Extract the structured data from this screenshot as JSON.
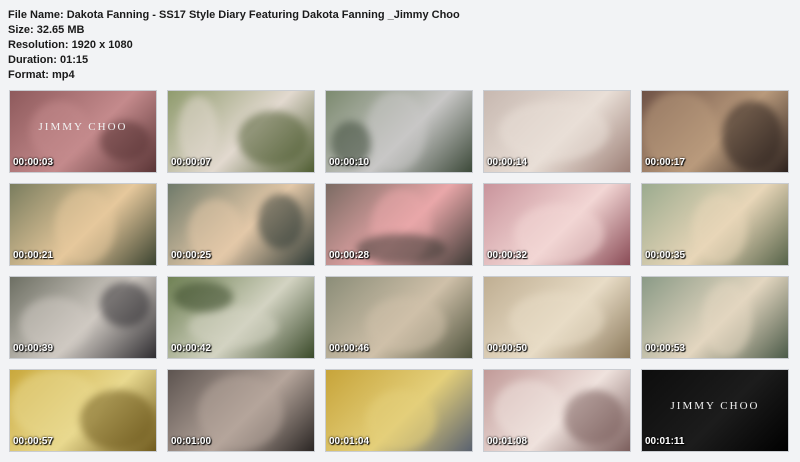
{
  "file_info": {
    "file_name_label": "File Name:",
    "file_name": "Dakota Fanning - SS17 Style Diary Featuring Dakota Fanning _Jimmy Choo",
    "size_label": "Size:",
    "size": "32.65 MB",
    "resolution_label": "Resolution:",
    "resolution": "1920 x 1080",
    "duration_label": "Duration:",
    "duration": "01:15",
    "format_label": "Format:",
    "format": "mp4"
  },
  "thumbnails": [
    {
      "time": "00:00:03",
      "scene": "brand-title-card",
      "colors": [
        "#8e5a5c",
        "#c48a8c",
        "#5a3536"
      ],
      "brand": "JIMMY CHOO"
    },
    {
      "time": "00:00:07",
      "scene": "shoe-closeup-garden",
      "colors": [
        "#8f9b6d",
        "#e2d9cf",
        "#4f5d32"
      ]
    },
    {
      "time": "00:00:10",
      "scene": "woman-on-ladder-garden",
      "colors": [
        "#7c8a6f",
        "#c8c7c6",
        "#3d4a3a"
      ]
    },
    {
      "time": "00:00:14",
      "scene": "pearl-handbag-closeup",
      "colors": [
        "#c7b8b0",
        "#e9dfd7",
        "#9c7f76"
      ]
    },
    {
      "time": "00:00:17",
      "scene": "shoe-rack-display",
      "colors": [
        "#6e5246",
        "#b99a7c",
        "#2c211d"
      ]
    },
    {
      "time": "00:00:21",
      "scene": "portrait-blonde-woman",
      "colors": [
        "#7a7d5e",
        "#e6c89c",
        "#3c4431"
      ]
    },
    {
      "time": "00:00:25",
      "scene": "woman-sunglasses-camera",
      "colors": [
        "#6f7a6a",
        "#e3c8a8",
        "#2f3a35"
      ]
    },
    {
      "time": "00:00:28",
      "scene": "woman-pink-dress",
      "colors": [
        "#7b6b63",
        "#e9a7a9",
        "#3e3a35"
      ]
    },
    {
      "time": "00:00:32",
      "scene": "embellished-bag-pink",
      "colors": [
        "#c9949c",
        "#f2d6d4",
        "#8a4b56"
      ]
    },
    {
      "time": "00:00:35",
      "scene": "woman-sunglasses-garden",
      "colors": [
        "#9bab8f",
        "#e8d6b8",
        "#566349"
      ]
    },
    {
      "time": "00:00:39",
      "scene": "sandals-on-rocks",
      "colors": [
        "#6d6f63",
        "#cfc9c2",
        "#2f2d31"
      ]
    },
    {
      "time": "00:00:42",
      "scene": "woman-reclining-garden",
      "colors": [
        "#6f8154",
        "#d3d3c2",
        "#3a4a2a"
      ]
    },
    {
      "time": "00:00:46",
      "scene": "stone-steps-garden",
      "colors": [
        "#8b8d78",
        "#cfc0a9",
        "#4f533d"
      ]
    },
    {
      "time": "00:00:50",
      "scene": "crystal-clutch-closeup",
      "colors": [
        "#bfae92",
        "#e8dcc6",
        "#8c7a5c"
      ]
    },
    {
      "time": "00:00:53",
      "scene": "woman-standing-trees",
      "colors": [
        "#8a9a86",
        "#e3d6c0",
        "#4b5a48"
      ]
    },
    {
      "time": "00:00:57",
      "scene": "yellow-tree-blossoms",
      "colors": [
        "#c9a83c",
        "#e9d98f",
        "#6f5a1d"
      ]
    },
    {
      "time": "00:01:00",
      "scene": "photographer-closeup",
      "colors": [
        "#5d5450",
        "#b5a59b",
        "#2b2624"
      ]
    },
    {
      "time": "00:01:04",
      "scene": "woman-on-yellow-leaves",
      "colors": [
        "#c7a43a",
        "#e4cf7a",
        "#5a6270"
      ]
    },
    {
      "time": "00:01:08",
      "scene": "soft-bokeh-flowers",
      "colors": [
        "#c19a98",
        "#efe2dd",
        "#7b5e5c"
      ]
    },
    {
      "time": "00:01:11",
      "scene": "brand-end-card",
      "colors": [
        "#0d0d0d",
        "#1c1c1c",
        "#000000"
      ],
      "brand": "JIMMY CHOO"
    }
  ]
}
